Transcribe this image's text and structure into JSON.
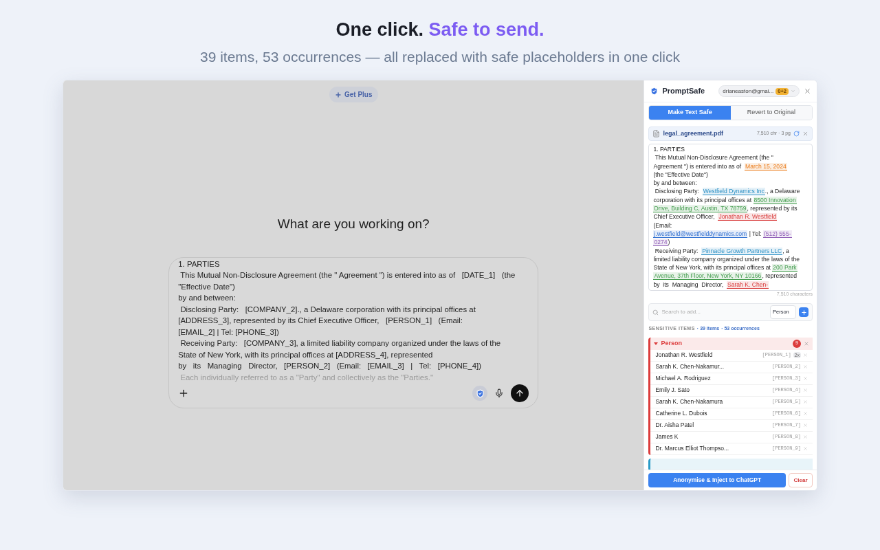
{
  "hero": {
    "title": "One click.",
    "title_accent": "Safe to send.",
    "subtitle": "39 items, 53 occurrences — all replaced with safe placeholders in one click"
  },
  "chat": {
    "get_plus": "Get Plus",
    "heading": "What are you working on?",
    "composer_lines": [
      {
        "text": "1. PARTIES",
        "faded": false
      },
      {
        "text": " This Mutual Non-Disclosure Agreement (the \" Agreement \") is entered into as of   [DATE_1]   (the",
        "faded": false
      },
      {
        "text": "\"Effective Date\")",
        "faded": false
      },
      {
        "text": "by and between:",
        "faded": false
      },
      {
        "text": " Disclosing Party:   [COMPANY_2]., a Delaware corporation with its principal offices at",
        "faded": false
      },
      {
        "text": "[ADDRESS_3], represented by its Chief Executive Officer,   [PERSON_1]   (Email:",
        "faded": false
      },
      {
        "text": "[EMAIL_2] | Tel: [PHONE_3])",
        "faded": false
      },
      {
        "text": " Receiving Party:   [COMPANY_3], a limited liability company organized under the laws of the",
        "faded": false
      },
      {
        "text": "State of New York, with its principal offices at [ADDRESS_4], represented",
        "faded": false
      },
      {
        "text": "by   its   Managing   Director,   [PERSON_2]   (Email:   [EMAIL_3]   |   Tel:   [PHONE_4])",
        "faded": false
      },
      {
        "text": " Each individually referred to as a \"Party\" and collectively as the \"Parties.\"",
        "faded": true
      }
    ]
  },
  "panel": {
    "brand": "PromptSafe",
    "account": "drianeaston@gmai...",
    "account_badge": "0+2",
    "tabs": [
      {
        "label": "Make Text Safe",
        "selected": true
      },
      {
        "label": "Revert to Original",
        "selected": false
      }
    ],
    "file": {
      "name": "legal_agreement.pdf",
      "meta": "7,510 chr · 3 pg"
    },
    "preview": [
      [
        {
          "text": "1. PARTIES"
        }
      ],
      [
        {
          "text": " This Mutual Non-Disclosure Agreement (the \""
        }
      ],
      [
        {
          "text": "Agreement \") is entered into as of  "
        },
        {
          "text": "March 15, 2024",
          "color": "#ea7a18"
        }
      ],
      [
        {
          "text": "(the \"Effective Date\")"
        }
      ],
      [
        {
          "text": "by and between:"
        }
      ],
      [
        {
          "text": " Disclosing Party:  "
        },
        {
          "text": "Westfield Dynamics Inc",
          "color": "#2a8fc4"
        },
        {
          "text": "., a Delaware"
        }
      ],
      [
        {
          "text": "corporation with its principal offices at "
        },
        {
          "text": "8500 Innovation",
          "color": "#3f9a4a"
        }
      ],
      [
        {
          "text": "Drive, Building C, Austin, TX 78759",
          "color": "#3f9a4a"
        },
        {
          "text": ", represented by its"
        }
      ],
      [
        {
          "text": "Chief Executive Officer,  "
        },
        {
          "text": "Jonathan R. Westfield",
          "color": "#d83a3a"
        }
      ],
      [
        {
          "text": "(Email:"
        }
      ],
      [
        {
          "text": "j.westfield@westfielddynamics.com",
          "color": "#2f6fd0"
        },
        {
          "text": " | Tel: "
        },
        {
          "text": "(512) 555-",
          "color": "#8e5bb5"
        }
      ],
      [
        {
          "text": "0274",
          "color": "#8e5bb5"
        },
        {
          "text": ")"
        }
      ],
      [
        {
          "text": " Receiving Party:  "
        },
        {
          "text": "Pinnacle Growth Partners LLC",
          "color": "#2a8fc4"
        },
        {
          "text": ", a"
        }
      ],
      [
        {
          "text": "limited liability company organized under the laws of the"
        }
      ],
      [
        {
          "text": "State of New York, with its principal offices at "
        },
        {
          "text": "200 Park",
          "color": "#3f9a4a"
        }
      ],
      [
        {
          "text": "Avenue, 37th Floor, New York, NY 10166",
          "color": "#3f9a4a"
        },
        {
          "text": ", represented"
        }
      ],
      [
        {
          "text": "by  its  Managing  Director,  "
        },
        {
          "text": "Sarah K. Chen-",
          "color": "#d83a3a"
        }
      ]
    ],
    "char_count": "7,510 characters",
    "search": {
      "placeholder": "Search to add...",
      "type_value": "Person"
    },
    "summary": {
      "label": "SENSITIVE ITEMS",
      "items": "· 39 items",
      "occurrences": "· 53 occurrences"
    },
    "groups": [
      {
        "label": "Person",
        "count": "9",
        "color": "#dc3c3c",
        "expanded": true,
        "items": [
          {
            "name": "Jonathan R. Westfield",
            "placeholder": "[PERSON_1]",
            "times": "2x"
          },
          {
            "name": "Sarah K. Chen-Nakamur...",
            "placeholder": "[PERSON_2]"
          },
          {
            "name": "Michael A. Rodriguez",
            "placeholder": "[PERSON_3]"
          },
          {
            "name": "Emily J. Sato",
            "placeholder": "[PERSON_4]"
          },
          {
            "name": "Sarah K. Chen-Nakamura",
            "placeholder": "[PERSON_5]"
          },
          {
            "name": "Catherine L. Dubois",
            "placeholder": "[PERSON_6]"
          },
          {
            "name": "Dr. Aisha Patel",
            "placeholder": "[PERSON_7]"
          },
          {
            "name": "James K",
            "placeholder": "[PERSON_8]"
          },
          {
            "name": "Dr. Marcus Elliot Thompso...",
            "placeholder": "[PERSON_9]"
          }
        ]
      },
      {
        "color": "#2a9bc8",
        "expanded": false
      }
    ],
    "primary_button": "Anonymise & Inject to ChatGPT",
    "clear_button": "Clear"
  }
}
